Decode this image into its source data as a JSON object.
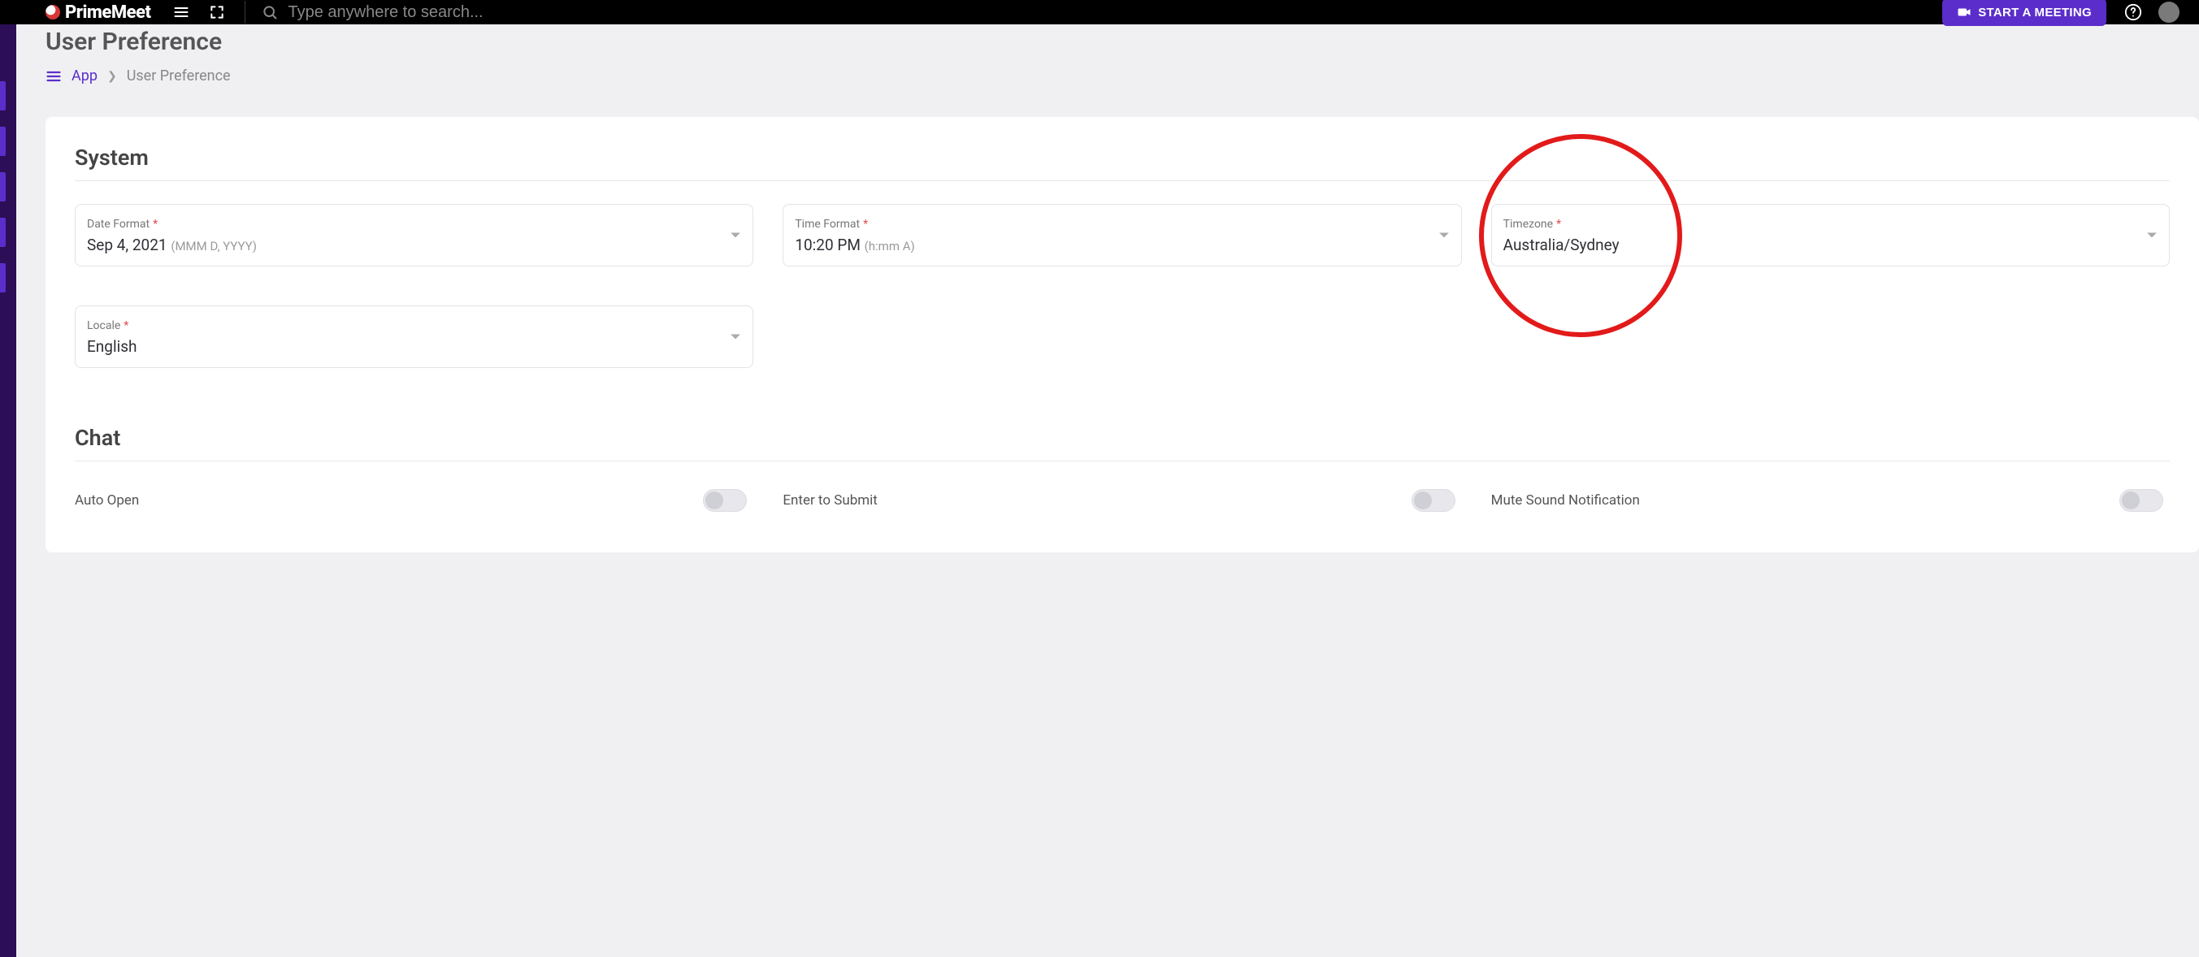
{
  "topbar": {
    "brand": "PrimeMeet",
    "search_placeholder": "Type anywhere to search...",
    "start_meeting_label": "START A MEETING"
  },
  "page": {
    "title": "User Preference",
    "breadcrumb": {
      "root": "App",
      "current": "User Preference"
    }
  },
  "sections": {
    "system": {
      "title": "System",
      "fields": {
        "date_format": {
          "label": "Date Format",
          "value": "Sep 4, 2021",
          "hint": "(MMM D, YYYY)"
        },
        "time_format": {
          "label": "Time Format",
          "value": "10:20 PM",
          "hint": "(h:mm A)"
        },
        "timezone": {
          "label": "Timezone",
          "value": "Australia/Sydney"
        },
        "locale": {
          "label": "Locale",
          "value": "English"
        }
      }
    },
    "chat": {
      "title": "Chat",
      "toggles": {
        "auto_open": {
          "label": "Auto Open"
        },
        "enter_submit": {
          "label": "Enter to Submit"
        },
        "mute_sound": {
          "label": "Mute Sound Notification"
        }
      }
    }
  }
}
